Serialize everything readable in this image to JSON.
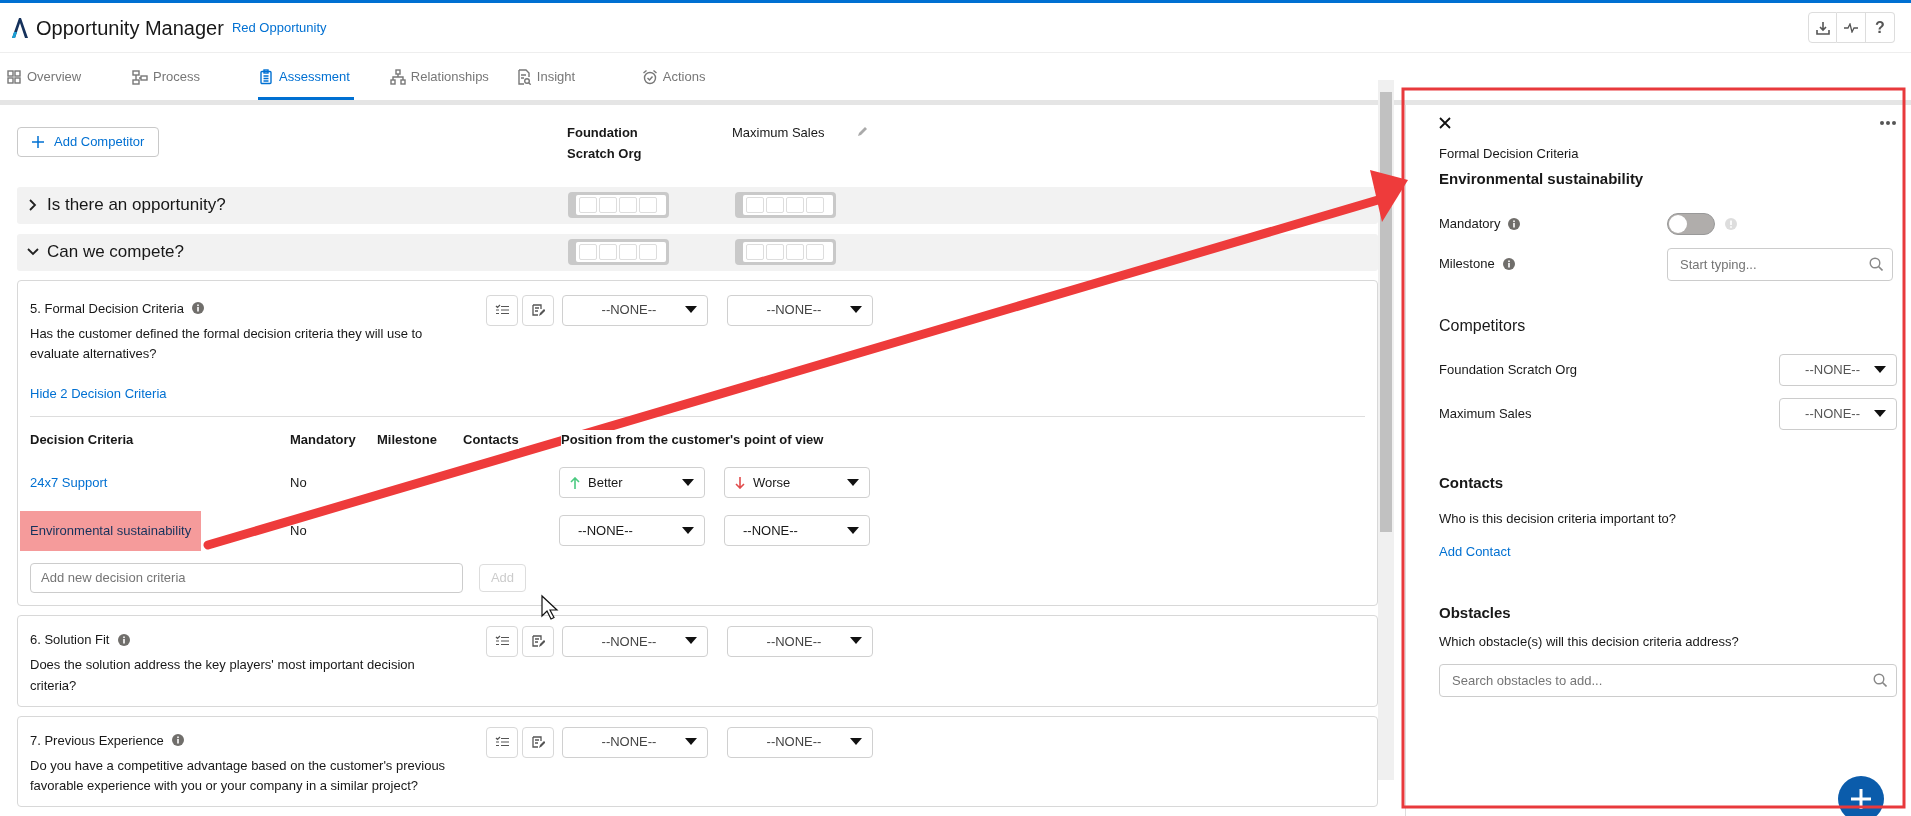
{
  "app": {
    "title": "Opportunity Manager",
    "record": "Red Opportunity"
  },
  "header_buttons": [
    {
      "kind": "download"
    },
    {
      "kind": "activity"
    },
    {
      "kind": "help",
      "label": "?"
    }
  ],
  "tabs": [
    {
      "label": "Overview",
      "kind": "grid",
      "selected": false
    },
    {
      "label": "Process",
      "kind": "process",
      "selected": false
    },
    {
      "label": "Assessment",
      "kind": "clipboard",
      "selected": true
    },
    {
      "label": "Relationships",
      "kind": "hierarchy",
      "selected": false
    },
    {
      "label": "Insight",
      "kind": "document",
      "selected": false
    },
    {
      "label": "Actions",
      "kind": "alarm",
      "selected": false
    }
  ],
  "add_competitor": "Add Competitor",
  "competitors": [
    "Foundation Scratch Org",
    "Maximum Sales"
  ],
  "sections": [
    {
      "title": "Is there an opportunity?",
      "expanded": false
    },
    {
      "title": "Can we compete?",
      "expanded": true
    }
  ],
  "questions": [
    {
      "title": "5. Formal Decision Criteria",
      "text": "Has the customer defined the formal decision criteria they will use to evaluate alternatives?",
      "ratings": [
        "--NONE--",
        "--NONE--"
      ],
      "criteria": {
        "toggle": "Hide 2 Decision Criteria",
        "columns": [
          "Decision Criteria",
          "Mandatory",
          "Milestone",
          "Contacts",
          "Position from the customer's point of view"
        ],
        "rows": [
          {
            "name": "24x7 Support",
            "mandatory": "No",
            "highlighted": false,
            "positions": [
              {
                "label": "Better",
                "kind": "up"
              },
              {
                "label": "Worse",
                "kind": "down"
              }
            ]
          },
          {
            "name": "Environmental sustainability",
            "mandatory": "No",
            "highlighted": true,
            "positions": [
              {
                "label": "--NONE--",
                "kind": "plain"
              },
              {
                "label": "--NONE--",
                "kind": "plain"
              }
            ]
          }
        ],
        "new_placeholder": "Add new decision criteria",
        "add_button": {
          "label": "Add",
          "disabled": true
        }
      }
    },
    {
      "title": "6. Solution Fit",
      "text": "Does the solution address the key players' most important decision criteria?",
      "ratings": [
        "--NONE--",
        "--NONE--"
      ]
    },
    {
      "title": "7. Previous Experience",
      "text": "Do you have a competitive advantage based on the customer's previous favorable experience with you or your company in a similar project?",
      "ratings": [
        "--NONE--",
        "--NONE--"
      ]
    }
  ],
  "panel": {
    "category": "Formal Decision Criteria",
    "title": "Environmental sustainability",
    "mandatory": {
      "label": "Mandatory",
      "on": false
    },
    "milestone": {
      "label": "Milestone",
      "placeholder": "Start typing..."
    },
    "competitors_heading": "Competitors",
    "competitor_positions": [
      {
        "name": "Foundation Scratch Org",
        "value": "--NONE--"
      },
      {
        "name": "Maximum Sales",
        "value": "--NONE--"
      }
    ],
    "contacts": {
      "heading": "Contacts",
      "text": "Who is this decision criteria important to?",
      "link": "Add Contact"
    },
    "obstacles": {
      "heading": "Obstacles",
      "text": "Which obstacle(s) will this decision criteria address?",
      "placeholder": "Search obstacles to add..."
    }
  }
}
